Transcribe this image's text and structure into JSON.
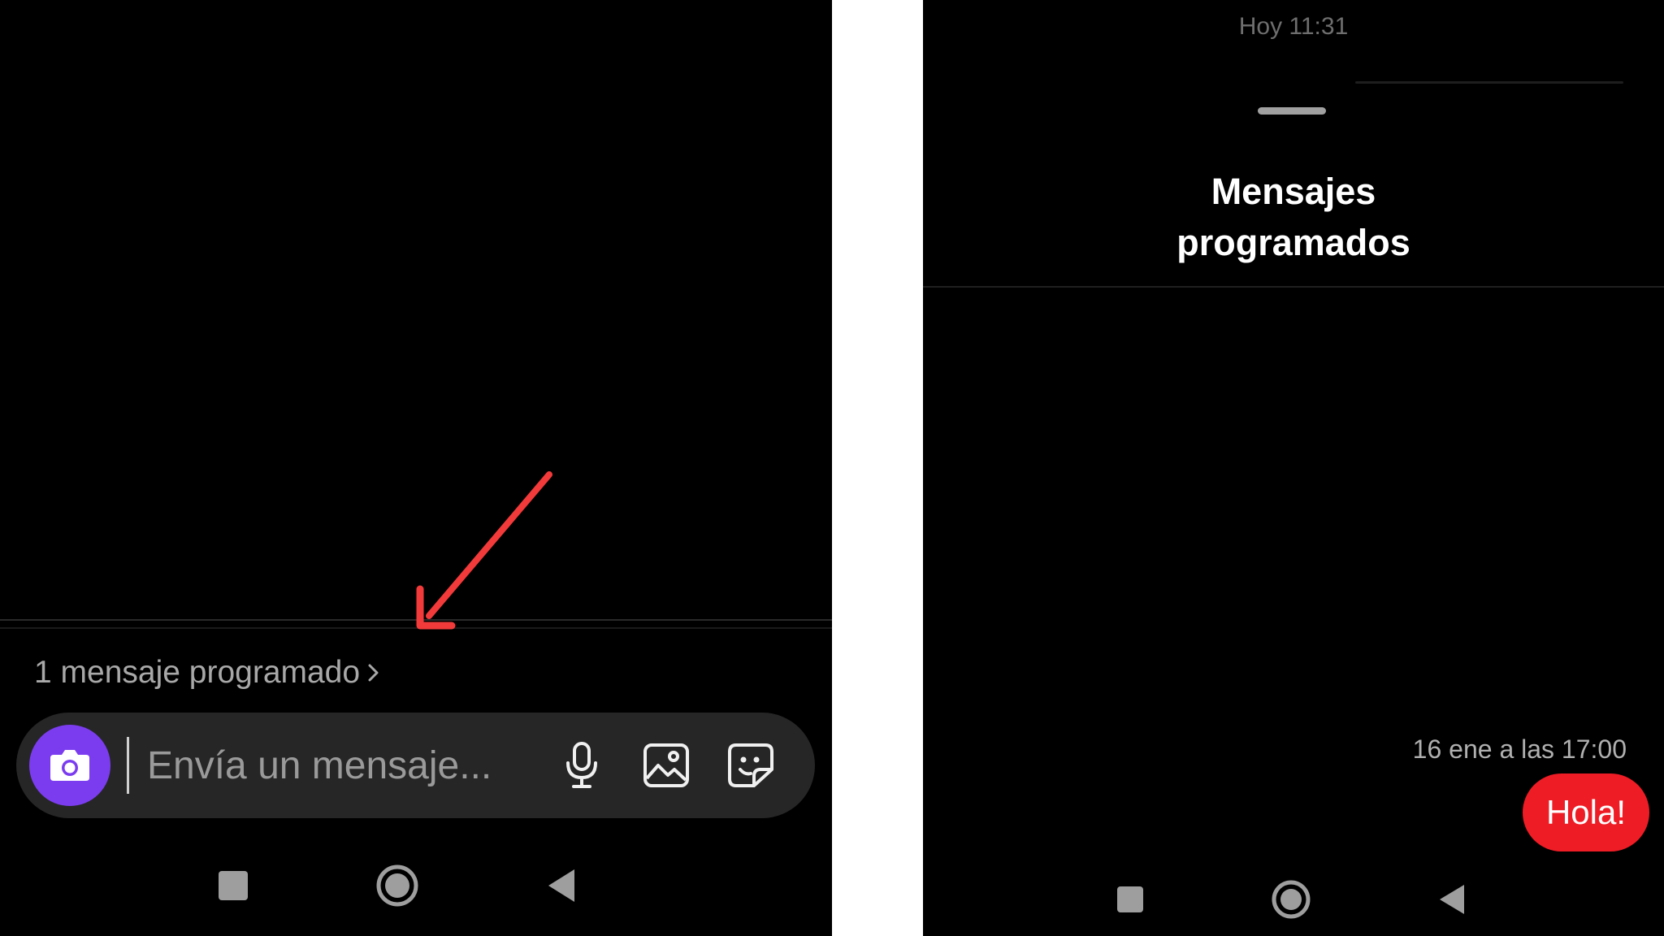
{
  "left_screen": {
    "scheduled_link": {
      "label": "1 mensaje programado"
    },
    "composer": {
      "input_placeholder": "Envía un mensaje...",
      "input_value": ""
    },
    "icons": {
      "camera": "camera-icon",
      "mic": "microphone-icon",
      "gallery": "image-icon",
      "sticker": "sticker-icon",
      "chevron": "chevron-right-icon"
    },
    "annotation_arrow_color": "#f23a3a",
    "camera_button_color": "#7b3cf0"
  },
  "right_screen": {
    "top_timestamp": "Hoy 11:31",
    "title": "Mensajes programados",
    "scheduled_message": {
      "time": "16 ene a las 17:00",
      "text": "Hola!",
      "bubble_color": "#ee1c25"
    }
  },
  "navbar": {
    "items": [
      "recents-square-icon",
      "home-circle-icon",
      "back-triangle-icon"
    ]
  }
}
